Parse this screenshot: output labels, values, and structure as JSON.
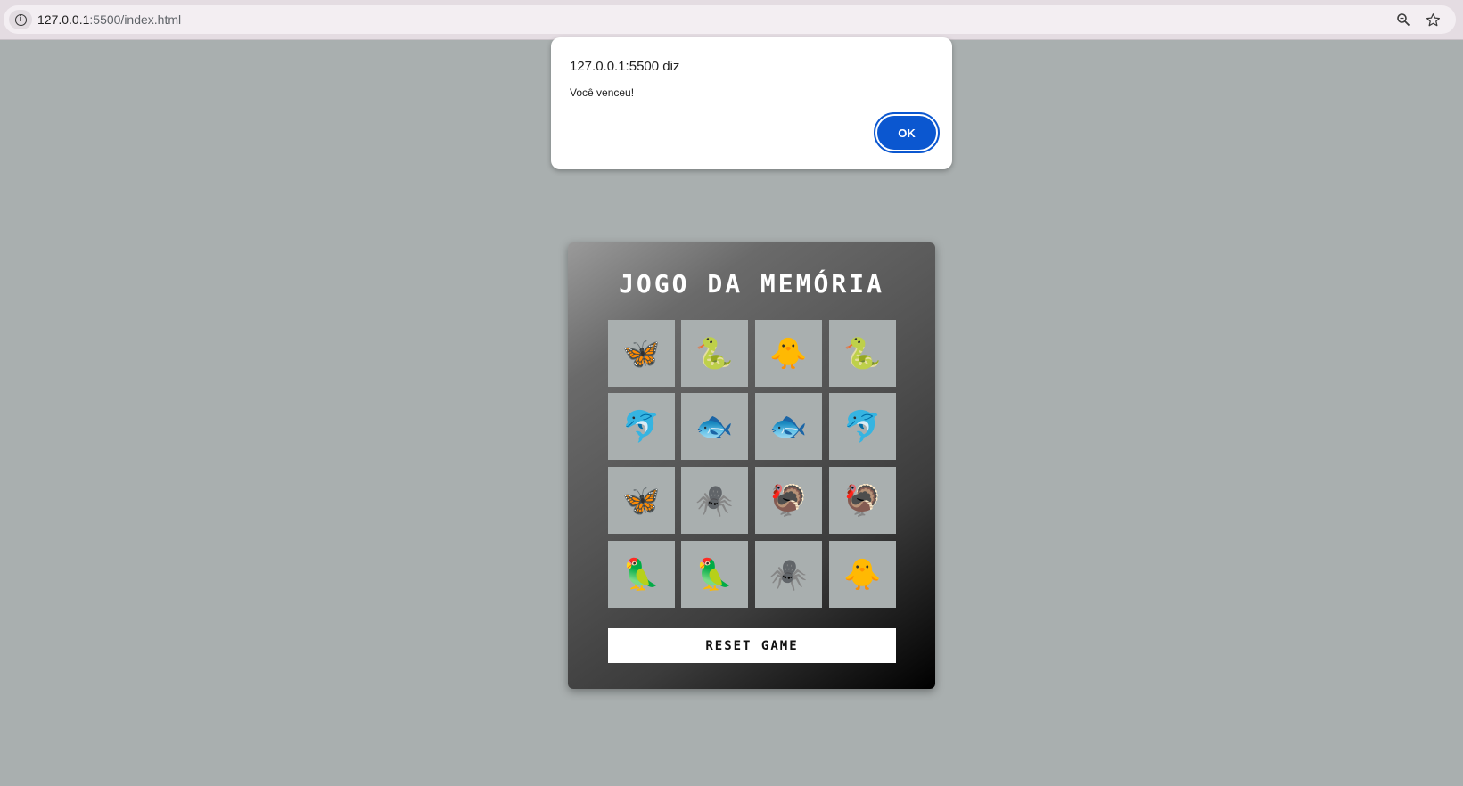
{
  "browser": {
    "url_host": "127.0.0.1",
    "url_rest": ":5500/index.html",
    "site_info_icon": "info-icon",
    "zoom_icon": "zoom-icon",
    "bookmark_icon": "star-icon"
  },
  "alert": {
    "title": "127.0.0.1:5500 diz",
    "message": "Você venceu!",
    "ok_label": "OK"
  },
  "game": {
    "title": "JOGO DA MEMÓRIA",
    "reset_label": "RESET GAME",
    "cards": [
      {
        "emoji": "🦋",
        "name": "butterfly"
      },
      {
        "emoji": "🐍",
        "name": "snake"
      },
      {
        "emoji": "🐥",
        "name": "chick"
      },
      {
        "emoji": "🐍",
        "name": "snake"
      },
      {
        "emoji": "🐬",
        "name": "dolphin"
      },
      {
        "emoji": "🐟",
        "name": "fish"
      },
      {
        "emoji": "🐟",
        "name": "fish"
      },
      {
        "emoji": "🐬",
        "name": "dolphin"
      },
      {
        "emoji": "🦋",
        "name": "butterfly"
      },
      {
        "emoji": "🕷️",
        "name": "spider"
      },
      {
        "emoji": "🦃",
        "name": "turkey"
      },
      {
        "emoji": "🦃",
        "name": "turkey"
      },
      {
        "emoji": "🦜",
        "name": "parrot"
      },
      {
        "emoji": "🦜",
        "name": "parrot"
      },
      {
        "emoji": "🕷️",
        "name": "spider"
      },
      {
        "emoji": "🐥",
        "name": "chick"
      }
    ]
  }
}
